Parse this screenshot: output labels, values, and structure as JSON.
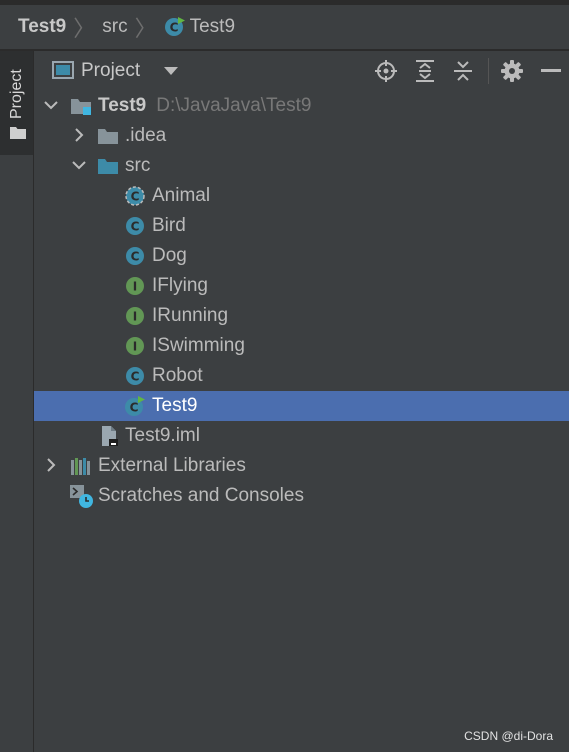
{
  "breadcrumb": {
    "items": [
      "Test9",
      "src",
      "Test9"
    ]
  },
  "sidebar": {
    "tab_label": "Project"
  },
  "header": {
    "title": "Project",
    "buttons": [
      "locate-icon",
      "expand-all-icon",
      "collapse-all-icon",
      "settings-icon",
      "hide-icon"
    ]
  },
  "tree": {
    "root": {
      "label": "Test9",
      "path": "D:\\JavaJava\\Test9"
    },
    "idea": {
      "label": ".idea"
    },
    "src": {
      "label": "src"
    },
    "classes": [
      {
        "label": "Animal",
        "kind": "abstract-class"
      },
      {
        "label": "Bird",
        "kind": "class"
      },
      {
        "label": "Dog",
        "kind": "class"
      },
      {
        "label": "IFlying",
        "kind": "interface"
      },
      {
        "label": "IRunning",
        "kind": "interface"
      },
      {
        "label": "ISwimming",
        "kind": "interface"
      },
      {
        "label": "Robot",
        "kind": "class"
      },
      {
        "label": "Test9",
        "kind": "main-class"
      }
    ],
    "iml": {
      "label": "Test9.iml"
    },
    "libraries": {
      "label": "External Libraries"
    },
    "scratches": {
      "label": "Scratches and Consoles"
    }
  },
  "colors": {
    "background": "#3c3f41",
    "selection": "#4b6eaf",
    "class_icon": "#3d8ba8",
    "interface_icon": "#629755",
    "folder": "#87939a"
  },
  "watermark": "CSDN @di-Dora"
}
